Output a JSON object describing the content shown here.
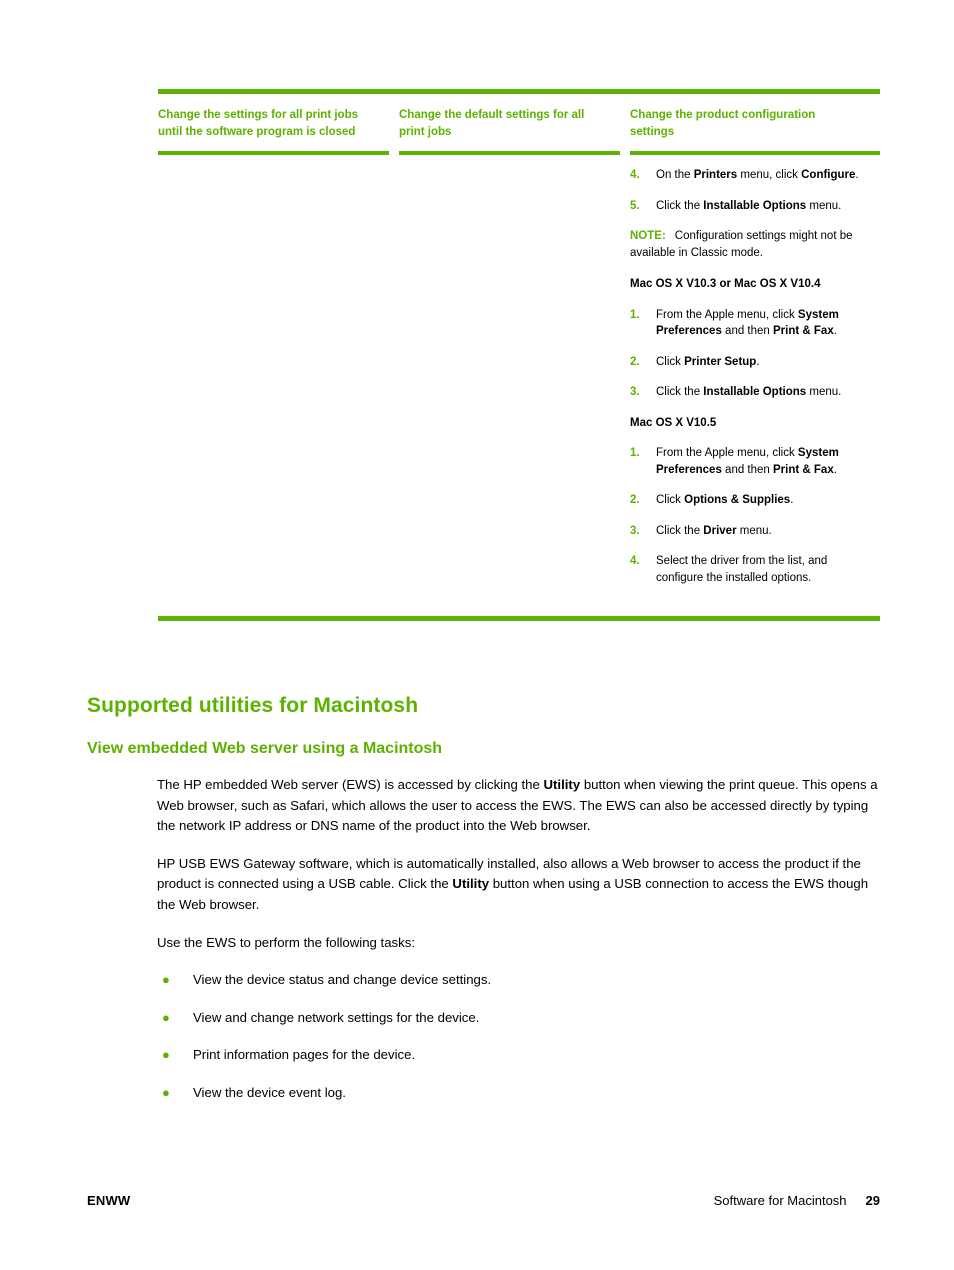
{
  "table": {
    "headers": [
      "Change the settings for all print jobs until the software program is closed",
      "Change the default settings for all print jobs",
      "Change the product configuration settings"
    ],
    "column3_blocks": [
      {
        "kind": "step",
        "num": "4.",
        "html": "On the <b>Printers</b> menu, click <b>Configure</b>."
      },
      {
        "kind": "step",
        "num": "5.",
        "html": "Click the <b>Installable Options</b> menu."
      },
      {
        "kind": "note",
        "label": "NOTE:",
        "html": "Configuration settings might not be available in Classic mode."
      },
      {
        "kind": "subhead",
        "html": "Mac OS X V10.3 or Mac OS X V10.4"
      },
      {
        "kind": "step",
        "num": "1.",
        "html": "From the Apple menu, click <b>System Preferences</b> and then <b>Print &amp; Fax</b>."
      },
      {
        "kind": "step",
        "num": "2.",
        "html": "Click <b>Printer Setup</b>."
      },
      {
        "kind": "step",
        "num": "3.",
        "html": "Click the <b>Installable Options</b> menu."
      },
      {
        "kind": "subhead",
        "html": "Mac OS X V10.5"
      },
      {
        "kind": "step",
        "num": "1.",
        "html": "From the Apple menu, click <b>System Preferences</b> and then <b>Print &amp; Fax</b>."
      },
      {
        "kind": "step",
        "num": "2.",
        "html": "Click <b>Options &amp; Supplies</b>."
      },
      {
        "kind": "step",
        "num": "3.",
        "html": "Click the <b>Driver</b> menu."
      },
      {
        "kind": "step",
        "num": "4.",
        "html": "Select the driver from the list, and configure the installed options."
      }
    ]
  },
  "headings": {
    "h1": "Supported utilities for Macintosh",
    "h2": "View embedded Web server using a Macintosh"
  },
  "body": {
    "paragraphs": [
      "The HP embedded Web server (EWS) is accessed by clicking the <b>Utility</b> button when viewing the print queue. This opens a Web browser, such as Safari, which allows the user to access the EWS. The EWS can also be accessed directly by typing the network IP address or DNS name of the product into the Web browser.",
      "HP USB EWS Gateway software, which is automatically installed, also allows a Web browser to access the product if the product is connected using a USB cable. Click the <b>Utility</b> button when using a USB connection to access the EWS though the Web browser.",
      "Use the EWS to perform the following tasks:"
    ],
    "bullets": [
      "View the device status and change device settings.",
      "View and change network settings for the device.",
      "Print information pages for the device.",
      "View the device event log."
    ],
    "bullet_glyph": "●"
  },
  "footer": {
    "left": "ENWW",
    "title": "Software for Macintosh",
    "page": "29"
  },
  "colors": {
    "accent_green": "#5CB200",
    "text": "#000000"
  }
}
